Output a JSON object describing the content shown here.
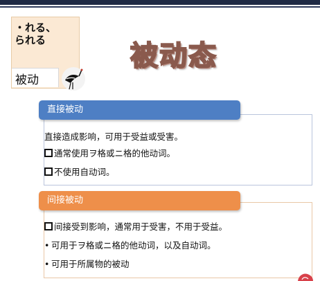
{
  "slide": {
    "side_card": {
      "text": "・れる、\n られる",
      "tab_label": "被动"
    },
    "title": "被动态",
    "sections": [
      {
        "header": "直接被动",
        "color": "#4e7fc4",
        "lines": [
          {
            "marker": "none",
            "text": "直接造成影响，可用于受益或受害。"
          },
          {
            "marker": "square",
            "text": "通常使用ヲ格或ニ格的他动词。"
          },
          {
            "marker": "square",
            "text": "不使用自动词。"
          }
        ]
      },
      {
        "header": "间接被动",
        "color": "#ee8f4a",
        "lines": [
          {
            "marker": "square",
            "text": "间接受到影响，通常用于受害，不用于受益。"
          },
          {
            "marker": "bullet",
            "text": "可用于ヲ格或ニ格的他动词，以及自动词。"
          },
          {
            "marker": "bullet",
            "text": "可用于所属物的被动"
          }
        ]
      }
    ]
  }
}
